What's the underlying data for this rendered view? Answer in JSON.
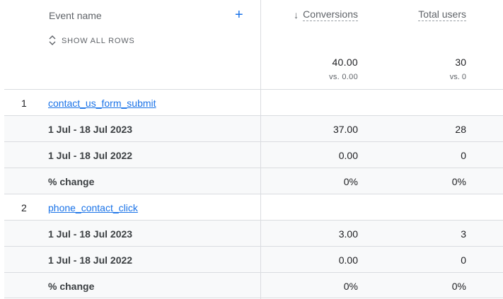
{
  "header": {
    "event_name_label": "Event name",
    "add_icon": "+",
    "show_all_rows": "SHOW ALL ROWS",
    "conversions_label": "Conversions",
    "sort_icon": "↓",
    "total_users_label": "Total users"
  },
  "totals": {
    "conversions": "40.00",
    "conversions_vs": "vs. 0.00",
    "total_users": "30",
    "total_users_vs": "vs. 0"
  },
  "events": [
    {
      "index": "1",
      "name": "contact_us_form_submit",
      "rows": [
        {
          "label": "1 Jul - 18 Jul 2023",
          "conversions": "37.00",
          "users": "28"
        },
        {
          "label": "1 Jul - 18 Jul 2022",
          "conversions": "0.00",
          "users": "0"
        },
        {
          "label": "% change",
          "conversions": "0%",
          "users": "0%"
        }
      ]
    },
    {
      "index": "2",
      "name": "phone_contact_click",
      "rows": [
        {
          "label": "1 Jul - 18 Jul 2023",
          "conversions": "3.00",
          "users": "3"
        },
        {
          "label": "1 Jul - 18 Jul 2022",
          "conversions": "0.00",
          "users": "0"
        },
        {
          "label": "% change",
          "conversions": "0%",
          "users": "0%"
        }
      ]
    }
  ],
  "colors": {
    "link": "#1a73e8",
    "row_shade": "#f8f9fa",
    "divider": "#dadce0"
  }
}
